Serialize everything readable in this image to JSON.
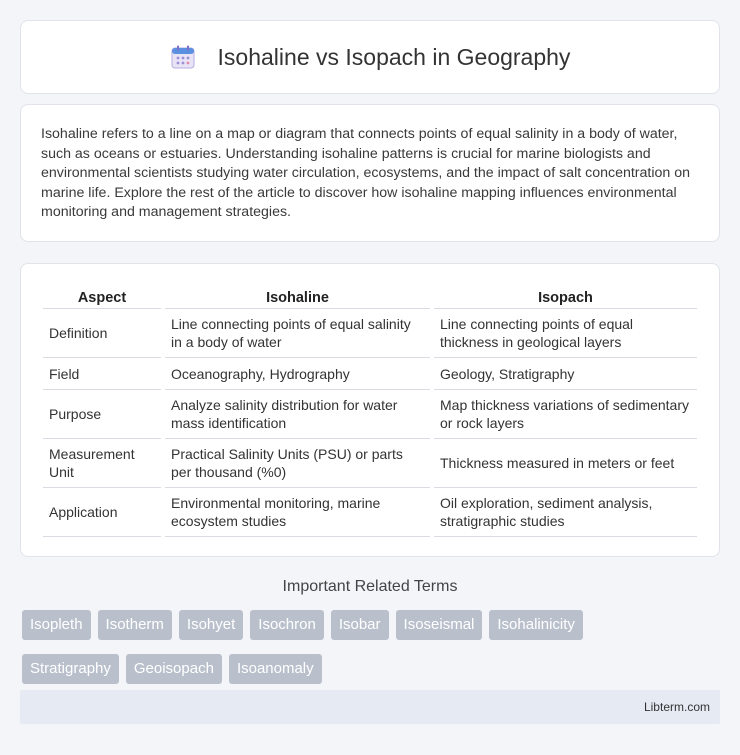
{
  "header": {
    "title": "Isohaline vs Isopach in Geography",
    "icon": "calendar-icon"
  },
  "intro": {
    "text": "Isohaline refers to a line on a map or diagram that connects points of equal salinity in a body of water, such as oceans or estuaries. Understanding isohaline patterns is crucial for marine biologists and environmental scientists studying water circulation, ecosystems, and the impact of salt concentration on marine life. Explore the rest of the article to discover how isohaline mapping influences environmental monitoring and management strategies."
  },
  "table": {
    "headers": [
      "Aspect",
      "Isohaline",
      "Isopach"
    ],
    "rows": [
      [
        "Definition",
        "Line connecting points of equal salinity in a body of water",
        "Line connecting points of equal thickness in geological layers"
      ],
      [
        "Field",
        "Oceanography, Hydrography",
        "Geology, Stratigraphy"
      ],
      [
        "Purpose",
        "Analyze salinity distribution for water mass identification",
        "Map thickness variations of sedimentary or rock layers"
      ],
      [
        "Measurement Unit",
        "Practical Salinity Units (PSU) or parts per thousand (%0)",
        "Thickness measured in meters or feet"
      ],
      [
        "Application",
        "Environmental monitoring, marine ecosystem studies",
        "Oil exploration, sediment analysis, stratigraphic studies"
      ]
    ]
  },
  "related": {
    "title": "Important Related Terms",
    "tags": [
      "Isopleth",
      "Isotherm",
      "Isohyet",
      "Isochron",
      "Isobar",
      "Isoseismal",
      "Isohalinicity",
      "Stratigraphy",
      "Geoisopach",
      "Isoanomaly"
    ]
  },
  "footer": {
    "text": "Libterm.com"
  }
}
